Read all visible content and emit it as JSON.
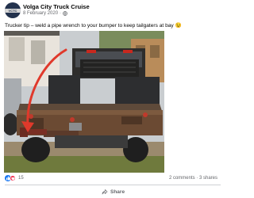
{
  "post": {
    "author": "Volga City Truck Cruise",
    "avatar_text": "VCTC",
    "date": "8 February 2020",
    "separator": "·",
    "privacy_icon": "globe-icon",
    "caption": "Trucker tip – weld a pipe wrench to your bumper to keep tailgaters at bay 😉",
    "photo_subject": "pickup-truck-flatbed-with-pipe-wrench-bumper"
  },
  "stats": {
    "reaction_icons": [
      "like-icon",
      "love-icon"
    ],
    "reaction_count": "15",
    "comments_shares": "2 comments · 3 shares"
  },
  "actions": {
    "share_label": "Share",
    "share_icon": "share-arrow-icon"
  },
  "colors": {
    "accent": "#1877f2",
    "love": "#f02849",
    "muted_text": "#65676b",
    "arrow": "#e0392b"
  }
}
